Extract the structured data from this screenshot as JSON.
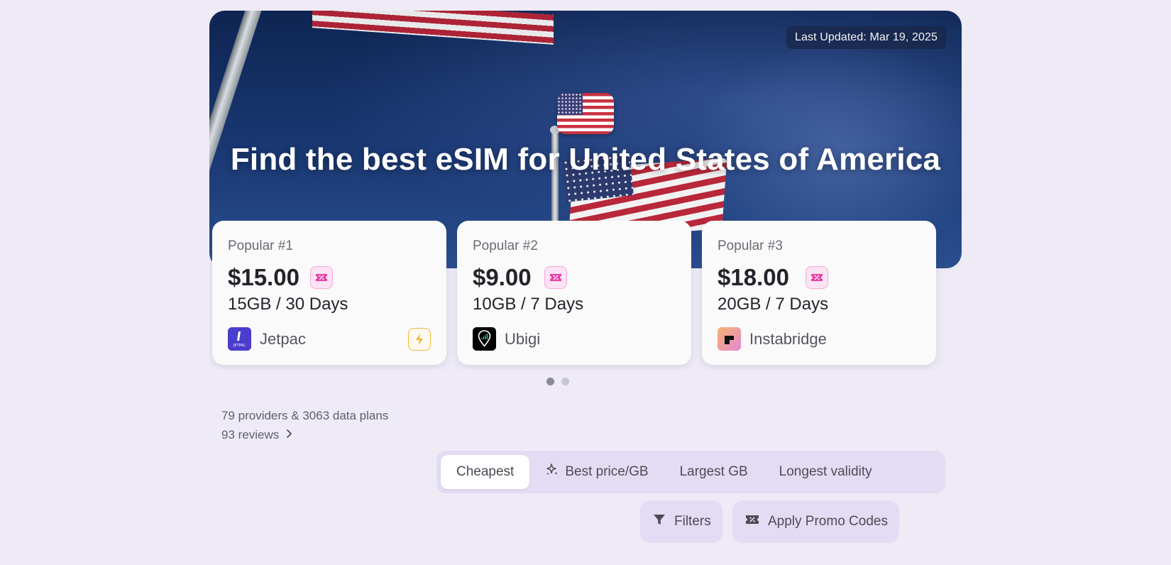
{
  "hero": {
    "last_updated": "Last Updated: Mar 19, 2025",
    "title": "Find the best eSIM for United States of America",
    "flag_icon": "us-flag-icon"
  },
  "cards": [
    {
      "rank": "Popular #1",
      "price": "$15.00",
      "plan": "15GB / 30 Days",
      "provider": "Jetpac",
      "logo_color": "#4b3fcf",
      "has_bolt": true
    },
    {
      "rank": "Popular #2",
      "price": "$9.00",
      "plan": "10GB / 7 Days",
      "provider": "Ubigi",
      "logo_color": "#000000",
      "has_bolt": false
    },
    {
      "rank": "Popular #3",
      "price": "$18.00",
      "plan": "20GB / 7 Days",
      "provider": "Instabridge",
      "logo_color": "#f4a76a",
      "has_bolt": false
    }
  ],
  "carousel": {
    "pages": 2,
    "active": 0
  },
  "summary": {
    "stats": "79 providers & 3063 data plans",
    "reviews": "93 reviews"
  },
  "sort_tabs": [
    {
      "label": "Cheapest",
      "active": true
    },
    {
      "label": "Best price/GB",
      "active": false,
      "icon": "sparkle-icon"
    },
    {
      "label": "Largest GB",
      "active": false
    },
    {
      "label": "Longest validity",
      "active": false
    }
  ],
  "actions": {
    "filters_label": "Filters",
    "promo_label": "Apply Promo Codes"
  },
  "colors": {
    "background": "#efebf6",
    "promo_pink": "#e83fa4",
    "accent_lavender": "#e3dcf4"
  }
}
